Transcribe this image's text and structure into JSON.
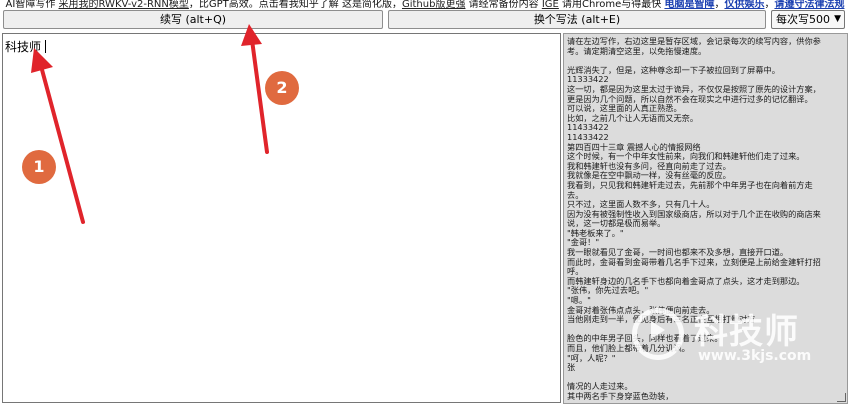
{
  "notice": {
    "part1": "AI智障写作 ",
    "link1": "采用我的RWKV-v2-RNN模型",
    "part2": "，比GPT高效。点击看我知乎了解",
    "part3": " 这是简化版，",
    "link2": "Github版更强",
    "part4": " 请经常备份内容 ",
    "link3": "IGE",
    "part5": " 请用Chrome与得最快 ",
    "bold1": "电脑是智障",
    "sep1": "，",
    "bold2": "仅供娱乐",
    "sep2": "，",
    "bold3": "请遵守法律法规"
  },
  "toolbar": {
    "continue_label": "续写 (alt+Q)",
    "rewrite_label": "换个写法 (alt+E)",
    "count_value": "每次写500"
  },
  "editor": {
    "text": "科技师"
  },
  "output_panel": {
    "lines": [
      "请在左边写作，右边这里是暂存区域，会记录每次的续写内容，供你参",
      "考。请定期清空这里，以免拖慢速度。",
      "",
      "光辉消失了，但是，这种尊念却一下子被拉回到了屏幕中。",
      "11333422",
      "这一切，都是因为这里太过于诡异，不仅仅是按照了原先的设计方案，",
      "更是因为几个问题，所以自然不会在现实之中进行过多的记忆翻译。",
      "可以说，这里面的人真正熟悉。",
      "比如，之前几个让人无语而又无奈。",
      "11433422",
      "11433422",
      "第四百四十三章 震撼人心的情报网络",
      "这个时候，有一个中年女性前来，向我们和韩建轩他们走了过来。",
      "我和韩建轩也没有多问，径直向前走了过去。",
      "我就像是在空中飘动一样，没有丝毫的反应。",
      "我看到，只见我和韩建轩走过去，先前那个中年男子也在向着前方走",
      "去。",
      "只不过，这里面人数不多，只有几十人。",
      "因为没有被强制性收入到国家级商店，所以对于几个正在收购的商店来",
      "说，这一切都是极而易举。",
      "\"韩老板来了。\"",
      "\"金哥！\"",
      "我一眼就看见了金哥，一时间也都来不及多想，直接开口道。",
      "而此时，金哥看到金哥带着几名手下过来，立刻便是上前给金建轩打招",
      "呼。",
      "而韩建轩身边的几名手下也都向着金哥点了点头，这才走到那边。",
      "\"张伟，你先过去吧。\"",
      "\"嗯。\"",
      "金哥对着张伟点点头，张伟便向前走去。",
      "当他刚走到一半，便见身后有三名正在互相打量对方",
      "",
      "脸色的中年男子回头，同样也看着了过来。",
      "而且，他们脸上都带着几分讥讽。",
      "\"呵，人呢？\"",
      "张",
      "",
      "情况的人走过来。",
      "其中两名手下身穿蓝色劲装，"
    ]
  },
  "watermark": {
    "main": "科技师",
    "sub": "www.3kjs.com"
  },
  "annotations": [
    {
      "label": "1"
    },
    {
      "label": "2"
    }
  ],
  "colors": {
    "annotation": "#e06a3f",
    "arrow": "#e0242b",
    "panel_bg": "#dcdcdc"
  }
}
